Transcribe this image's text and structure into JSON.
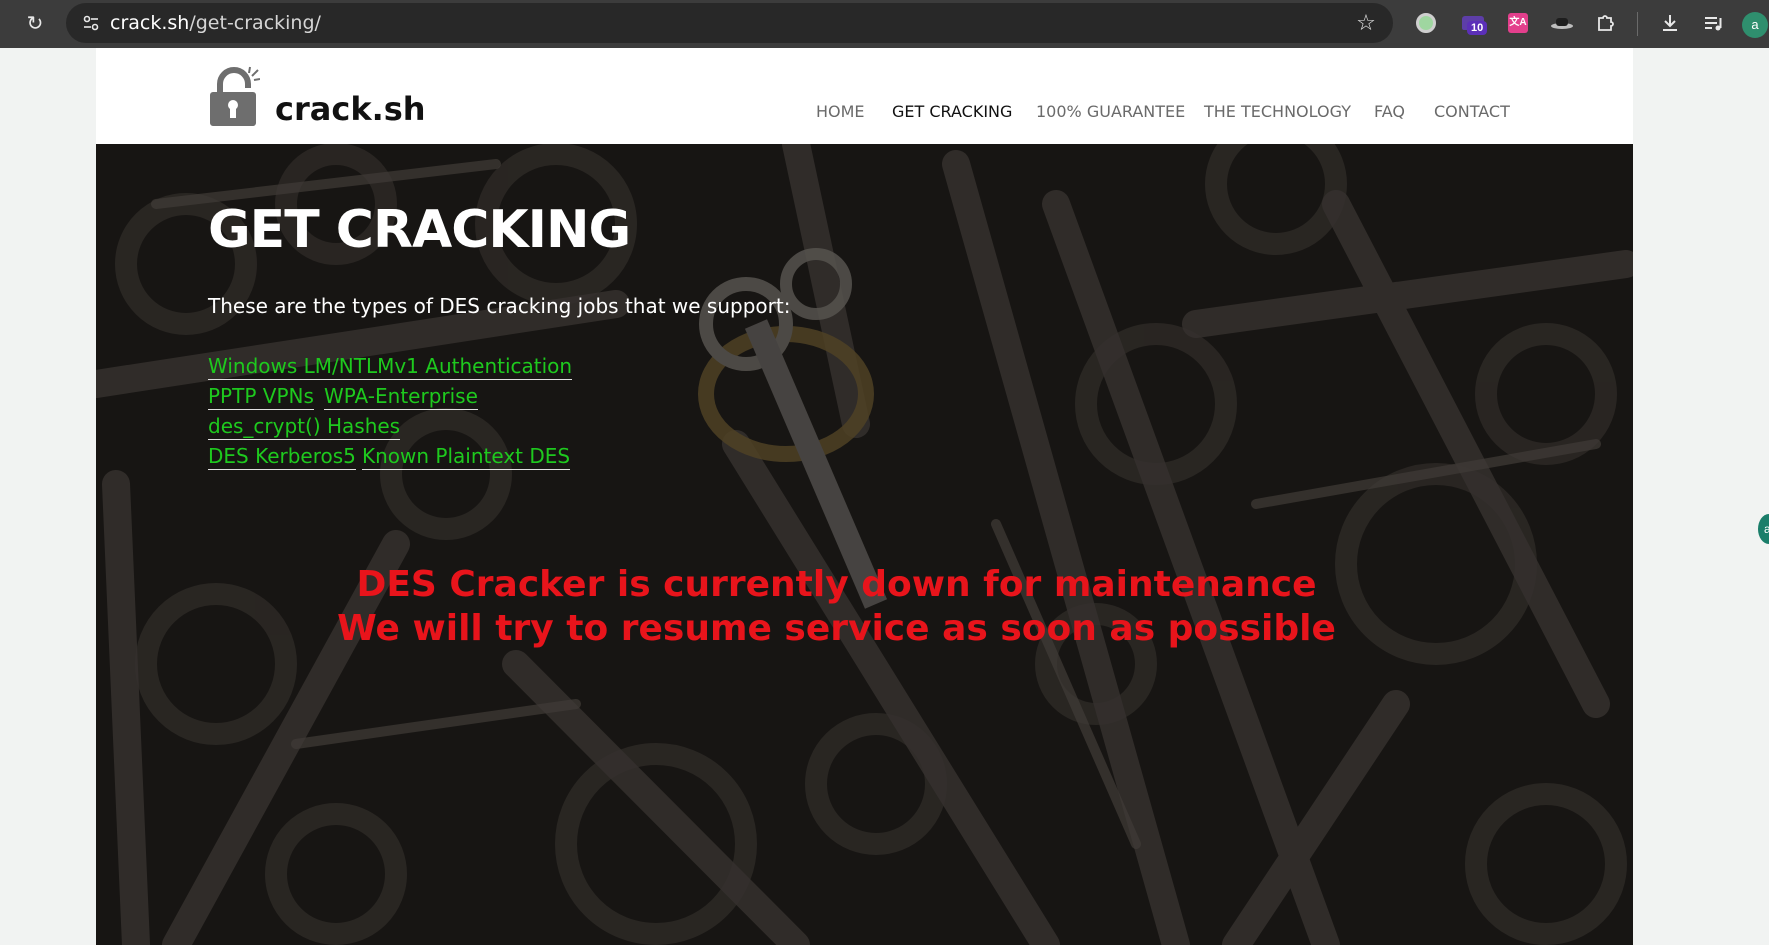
{
  "browser": {
    "url_host": "crack.sh",
    "url_path": "/get-cracking/",
    "extension_badge": "10",
    "translate_label": "文A",
    "profile_initial": "a",
    "side_initial": "a"
  },
  "site": {
    "brand": "crack.sh",
    "nav": [
      {
        "label": "HOME"
      },
      {
        "label": "GET CRACKING"
      },
      {
        "label": "100% GUARANTEE"
      },
      {
        "label": "THE TECHNOLOGY"
      },
      {
        "label": "FAQ"
      },
      {
        "label": "CONTACT"
      }
    ]
  },
  "hero": {
    "title": "GET CRACKING",
    "intro": "These are the types of DES cracking jobs that we support:",
    "jobs": [
      {
        "label": "Windows LM/NTLMv1 Authentication"
      },
      {
        "label": "PPTP VPNs"
      },
      {
        "label": "WPA-Enterprise"
      },
      {
        "label": "des_crypt() Hashes"
      },
      {
        "label": "DES Kerberos5"
      },
      {
        "label": "Known Plaintext DES"
      }
    ],
    "maintenance_line1": "DES Cracker is currently down for maintenance",
    "maintenance_line2": "We will try to resume service as soon as possible"
  },
  "colors": {
    "link": "#1ec91e",
    "maintenance": "#e8141b",
    "chrome": "#3c3c3c"
  }
}
